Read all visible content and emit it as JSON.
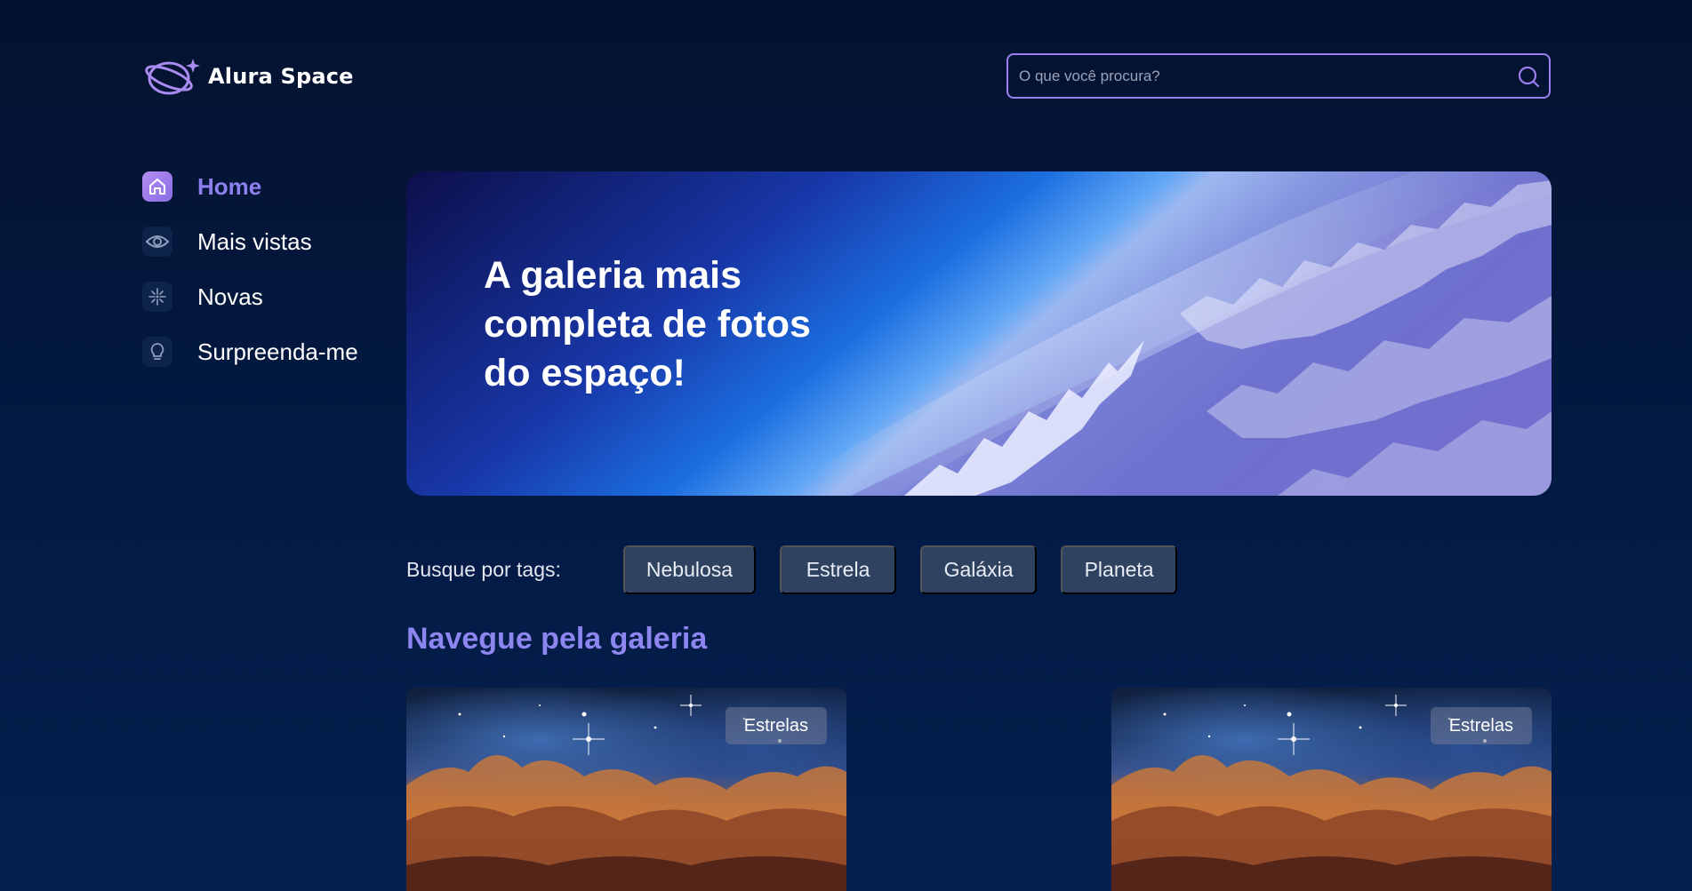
{
  "header": {
    "logo_text": "Alura Space",
    "search": {
      "placeholder": "O que você procura?",
      "value": ""
    }
  },
  "sidebar": {
    "items": [
      {
        "label": "Home",
        "icon": "home-icon",
        "active": true
      },
      {
        "label": "Mais vistas",
        "icon": "eye-icon",
        "active": false
      },
      {
        "label": "Novas",
        "icon": "sparkle-icon",
        "active": false
      },
      {
        "label": "Surpreenda-me",
        "icon": "lightbulb-icon",
        "active": false
      }
    ]
  },
  "banner": {
    "title": "A galeria mais completa de fotos do espaço!"
  },
  "tags": {
    "label": "Busque por tags:",
    "items": [
      "Nebulosa",
      "Estrela",
      "Galáxia",
      "Planeta"
    ]
  },
  "gallery": {
    "title": "Navegue pela galeria",
    "cards": [
      {
        "tag": "Estrelas"
      },
      {
        "tag": "Estrelas"
      }
    ]
  },
  "colors": {
    "background": "#04122f",
    "accent": "#8d85f0",
    "search_border": "#9a7ff0",
    "tag_bg": "#2f425f"
  }
}
